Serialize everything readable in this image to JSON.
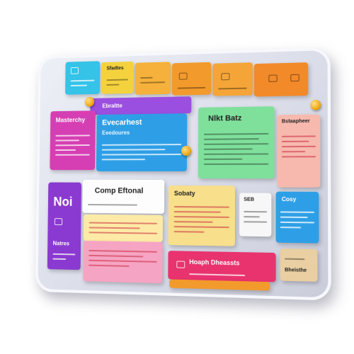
{
  "cards": {
    "top_cyan": "",
    "top_yellow": "Sfadtes",
    "top_orange": "",
    "purple_banner": "Ebraltte",
    "magenta": "Masterchy",
    "blue": {
      "title": "Evecarhest",
      "subtitle": "Eeedoures"
    },
    "green": "Nlkt Batz",
    "peach": "Bstaapheer",
    "violet": {
      "big": "Noi",
      "label": "Natres"
    },
    "white": "Comp Eftonal",
    "yellow": "Sobaty",
    "small_white": "SEB",
    "right_blue": "Cosy",
    "pink_bottom": "Hoaph Dheassts",
    "beige": "Bheisthe"
  },
  "colors": {
    "cyan": "#35c3e8",
    "yellow": "#f4d23e",
    "orange": "#f39a2c",
    "purple": "#9b4fe0",
    "magenta": "#d63fb3",
    "blue": "#2e9fe6",
    "green": "#7fe09b",
    "peach": "#f7b9ae",
    "violet": "#8a3ad0",
    "pink": "#f6a4c3",
    "light_yellow": "#f7df8b",
    "hot_pink": "#e8336f",
    "pale_pink": "#f5c3cf",
    "beige": "#e9cfa2"
  }
}
